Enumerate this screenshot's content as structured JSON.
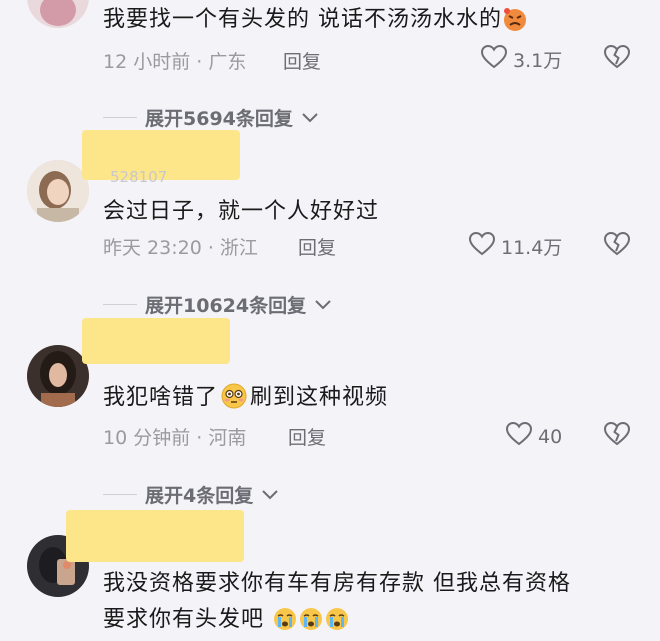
{
  "comments": [
    {
      "text": "我要找一个有头发的 说话不汤汤水水的",
      "time": "12 小时前 · 广东",
      "reply": "回复",
      "likes": "3.1万"
    },
    {
      "username_partial": "528107",
      "text": "会过日子，就一个人好好过",
      "time": "昨天 23:20 · 浙江",
      "reply": "回复",
      "likes": "11.4万"
    },
    {
      "text_a": "我犯啥错了",
      "text_b": "刷到这种视频",
      "time": "10 分钟前 · 河南",
      "reply": "回复",
      "likes": "40"
    },
    {
      "line1": "我没资格要求你有车有房有存款 但我总有资格",
      "line2": "要求你有头发吧"
    }
  ],
  "expand_links": [
    "展开5694条回复",
    "展开10624条回复",
    "展开4条回复"
  ],
  "colors": {
    "background": "#f4f3f7",
    "redaction": "#fde68a",
    "meta_text": "#9a9aa1"
  },
  "icons": [
    "heart-icon",
    "heart-broken-icon",
    "chevron-down-icon",
    "angry-emoji",
    "flushed-emoji",
    "crying-emoji"
  ]
}
